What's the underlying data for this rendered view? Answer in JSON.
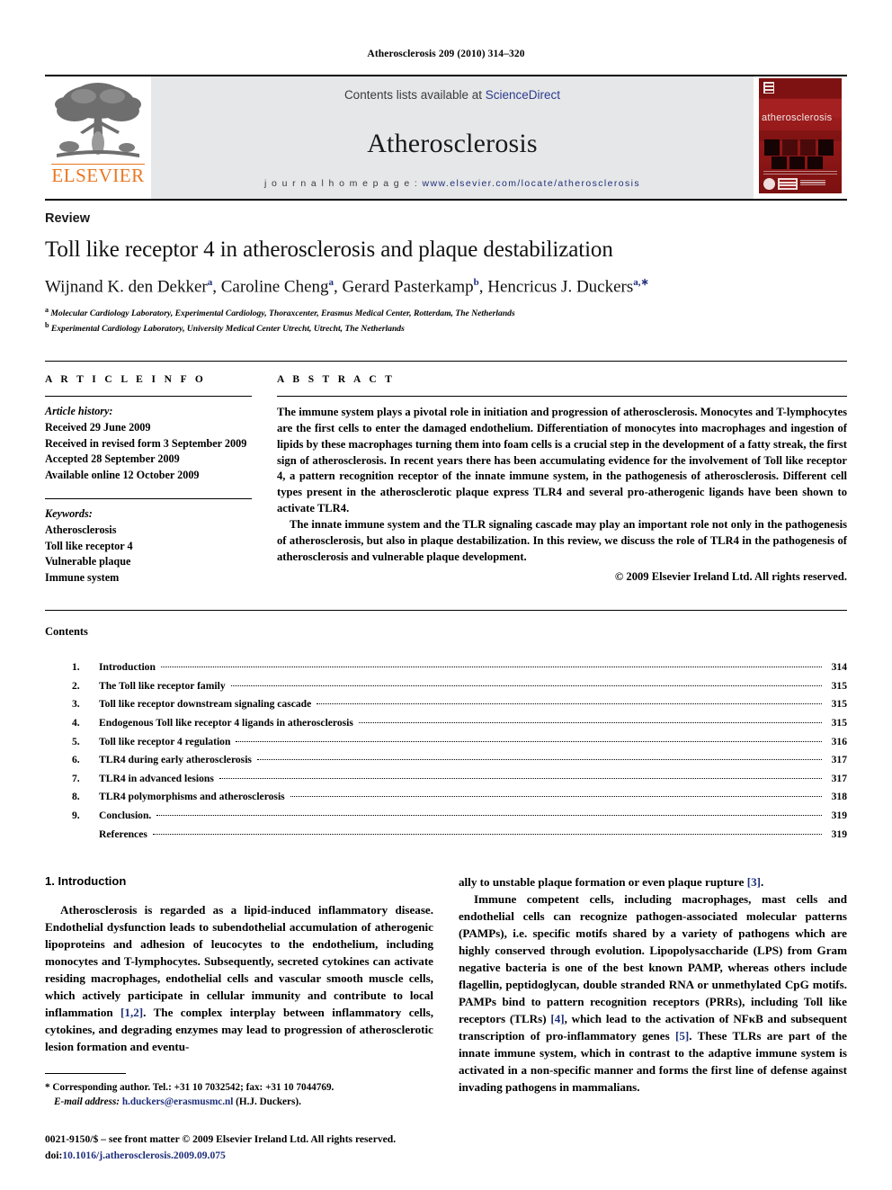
{
  "running_head": "Atherosclerosis 209 (2010) 314–320",
  "masthead": {
    "publisher_logo_text": "ELSEVIER",
    "contents_prefix": "Contents lists available at ",
    "contents_link": "ScienceDirect",
    "journal_name": "Atherosclerosis",
    "homepage_prefix": "j o u r n a l   h o m e p a g e :  ",
    "homepage_url": "www.elsevier.com/locate/atherosclerosis",
    "cover_title": "atherosclerosis"
  },
  "article": {
    "type": "Review",
    "title": "Toll like receptor 4 in atherosclerosis and plaque destabilization",
    "authors_html": "Wijnand K. den Dekker<sup>a</sup>, Caroline Cheng<sup>a</sup>, Gerard Pasterkamp<sup>b</sup>, Hencricus J. Duckers<sup>a,∗</sup>",
    "affiliations": [
      {
        "marker": "a",
        "text": "Molecular Cardiology Laboratory, Experimental Cardiology, Thoraxcenter, Erasmus Medical Center, Rotterdam, The Netherlands"
      },
      {
        "marker": "b",
        "text": "Experimental Cardiology Laboratory, University Medical Center Utrecht, Utrecht, The Netherlands"
      }
    ]
  },
  "article_info": {
    "heading": "A R T I C L E   I N F O",
    "history_label": "Article history:",
    "history": [
      "Received 29 June 2009",
      "Received in revised form 3 September 2009",
      "Accepted 28 September 2009",
      "Available online 12 October 2009"
    ],
    "keywords_label": "Keywords:",
    "keywords": [
      "Atherosclerosis",
      "Toll like receptor 4",
      "Vulnerable plaque",
      "Immune system"
    ]
  },
  "abstract": {
    "heading": "A B S T R A C T",
    "paragraphs": [
      "The immune system plays a pivotal role in initiation and progression of atherosclerosis. Monocytes and T-lymphocytes are the first cells to enter the damaged endothelium. Differentiation of monocytes into macrophages and ingestion of lipids by these macrophages turning them into foam cells is a crucial step in the development of a fatty streak, the first sign of atherosclerosis. In recent years there has been accumulating evidence for the involvement of Toll like receptor 4, a pattern recognition receptor of the innate immune system, in the pathogenesis of atherosclerosis. Different cell types present in the atherosclerotic plaque express TLR4 and several pro-atherogenic ligands have been shown to activate TLR4.",
      "The innate immune system and the TLR signaling cascade may play an important role not only in the pathogenesis of atherosclerosis, but also in plaque destabilization. In this review, we discuss the role of TLR4 in the pathogenesis of atherosclerosis and vulnerable plaque development."
    ],
    "copyright": "© 2009 Elsevier Ireland Ltd. All rights reserved."
  },
  "contents": {
    "heading": "Contents",
    "entries": [
      {
        "num": "1.",
        "label": "Introduction",
        "page": "314"
      },
      {
        "num": "2.",
        "label": "The Toll like receptor family",
        "page": "315"
      },
      {
        "num": "3.",
        "label": "Toll like receptor downstream signaling cascade",
        "page": "315"
      },
      {
        "num": "4.",
        "label": "Endogenous Toll like receptor 4 ligands in atherosclerosis",
        "page": "315"
      },
      {
        "num": "5.",
        "label": "Toll like receptor 4 regulation",
        "page": "316"
      },
      {
        "num": "6.",
        "label": "TLR4 during early atherosclerosis",
        "page": "317"
      },
      {
        "num": "7.",
        "label": "TLR4 in advanced lesions",
        "page": "317"
      },
      {
        "num": "8.",
        "label": "TLR4 polymorphisms and atherosclerosis",
        "page": "318"
      },
      {
        "num": "9.",
        "label": "Conclusion.",
        "page": "319"
      },
      {
        "num": "",
        "label": "References",
        "page": "319"
      }
    ]
  },
  "body": {
    "section_heading": "1.  Introduction",
    "left_paragraphs": [
      "Atherosclerosis is regarded as a lipid-induced inflammatory disease. Endothelial dysfunction leads to subendothelial accumulation of atherogenic lipoproteins and adhesion of leucocytes to the endothelium, including monocytes and T-lymphocytes. Subsequently, secreted cytokines can activate residing macrophages, endothelial cells and vascular smooth muscle cells, which actively participate in cellular immunity and contribute to local inflammation [1,2]. The complex interplay between inflammatory cells, cytokines, and degrading enzymes may lead to progression of atherosclerotic lesion formation and eventu-"
    ],
    "right_paragraphs": [
      "ally to unstable plaque formation or even plaque rupture [3].",
      "Immune competent cells, including macrophages, mast cells and endothelial cells can recognize pathogen-associated molecular patterns (PAMPs), i.e. specific motifs shared by a variety of pathogens which are highly conserved through evolution. Lipopolysaccharide (LPS) from Gram negative bacteria is one of the best known PAMP, whereas others include flagellin, peptidoglycan, double stranded RNA or unmethylated CpG motifs. PAMPs bind to pattern recognition receptors (PRRs), including Toll like receptors (TLRs) [4], which lead to the activation of NFκB and subsequent transcription of pro-inflammatory genes [5]. These TLRs are part of the innate immune system, which in contrast to the adaptive immune system is activated in a non-specific manner and forms the first line of defense against invading pathogens in mammalians."
    ]
  },
  "footnotes": {
    "corresponding": "* Corresponding author. Tel.: +31 10 7032542; fax: +31 10 7044769.",
    "email_label": "E-mail address:",
    "email": "h.duckers@erasmusmc.nl",
    "email_suffix": "(H.J. Duckers).",
    "issn_line": "0021-9150/$ – see front matter © 2009 Elsevier Ireland Ltd. All rights reserved.",
    "doi_label": "doi:",
    "doi": "10.1016/j.atherosclerosis.2009.09.075"
  },
  "colors": {
    "elsevier_orange": "#E87722",
    "link_blue": "#1f2f7a",
    "band_gray": "#e6e7e8",
    "cover_red": "#8d1414"
  }
}
